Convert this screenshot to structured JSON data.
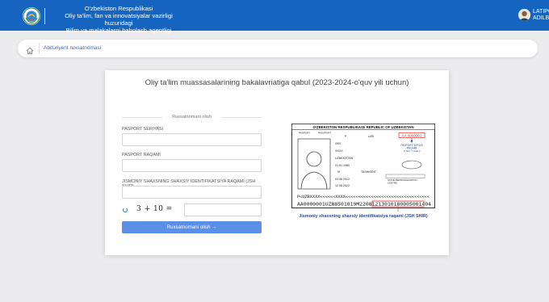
{
  "header": {
    "org_line1": "O'zbekiston Respublikasi",
    "org_line2": "Oliy ta'lim, fan va innovatsiyalar vazirligi huzuridagi",
    "org_line3": "Bilim va malakalarni baholash agentligi",
    "user_line1": "LATIPOV",
    "user_line2": "ADILBEK",
    "brand_color": "#1565c0"
  },
  "breadcrumb": {
    "home_icon": "home-icon",
    "current": "Abituriyent ruxsatnomasi"
  },
  "main": {
    "title": "Oliy ta'lim muassasalarining bakalavriatiga qabul (2023-2024-o'quv yili uchun)"
  },
  "form": {
    "heading": "Ruxsatnomani olish",
    "passport_series_label": "PASPORT SERIYASI",
    "passport_number_label": "PASPORT RAQAMI",
    "pinfl_label": "JISMONIY SHAXSNING SHAXSIY IDENTIFIKATSIYA RAQAMI (JSH SHIR)",
    "captcha_question": "3 + 10 =",
    "submit_label": "Ruxsatnomani olish →",
    "button_color": "#5b8ee6"
  },
  "passport_sample": {
    "header": "O'ZBEKISTON RESPUBLIKASI/ REPUBLIC OF UZBEKISTAN",
    "type_label": "PASPORT",
    "type_label2": "PASSPORT",
    "type_value": "P",
    "code_value": "UZB",
    "number_value": "AA 0000001",
    "series_note_line1": "PASPORT SERIYA",
    "series_note_line2": "RAQAMI",
    "series_note_line3": "(2 harf, 7 raqam)",
    "surname": "XXX",
    "given_name": "XXXX",
    "nationality": "UZBEKISTAN",
    "birth_date": "01 01 1980",
    "sex": "M",
    "birth_place": "TASHKENT",
    "issue_date": "03 08 2012",
    "expiry_date": "12 08 2022",
    "authority_line1": "STATE PERSONALIZATION",
    "authority_line2": "CENTRE",
    "mrz_line1": "P<UZBXXXX<<<<<<XXXX<<<<<<<<<<<<<<<<<<<<<<<<<<<<<<<<<",
    "mrz_line2_prefix": "AA0000001UZB8501019M2208121",
    "mrz_line2_pinfl": "30101800050014",
    "mrz_line2_suffix": "04",
    "caption": "Jismoniy shaxsning shaxsiy identifikatsiya raqami (JSH SHIR)"
  }
}
